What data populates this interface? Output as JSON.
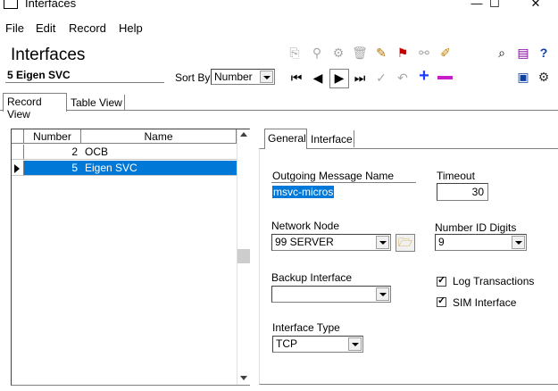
{
  "window": {
    "title": "Interfaces",
    "minimize": "—",
    "maximize": "☐",
    "close": "✕"
  },
  "menu": {
    "items": [
      "File",
      "Edit",
      "Record",
      "Help"
    ]
  },
  "header": {
    "heading": "Interfaces",
    "current_record": "5 Eigen SVC"
  },
  "sort": {
    "label": "Sort By",
    "value": "Number"
  },
  "view_tabs": [
    "Record View",
    "Table View"
  ],
  "table": {
    "columns": [
      "Number",
      "Name"
    ],
    "rows": [
      {
        "number": "2",
        "name": "OCB"
      },
      {
        "number": "5",
        "name": "Eigen SVC"
      }
    ]
  },
  "detail_tabs": [
    "General",
    "Interface"
  ],
  "form": {
    "outgoing_label": "Outgoing Message Name",
    "outgoing_value": "msvc-micros",
    "timeout_label": "Timeout",
    "timeout_value": "30",
    "network_node_label": "Network Node",
    "network_node_value": "99  SERVER",
    "number_id_label": "Number ID Digits",
    "number_id_value": "9",
    "backup_label": "Backup Interface",
    "backup_value": "",
    "log_label": "Log Transactions",
    "log_checked": true,
    "sim_label": "SIM Interface",
    "sim_checked": true,
    "type_label": "Interface Type",
    "type_value": "TCP"
  },
  "colors": {
    "selection": "#0078d7",
    "plus": "#1e3cff",
    "minus": "#c81ec8"
  }
}
